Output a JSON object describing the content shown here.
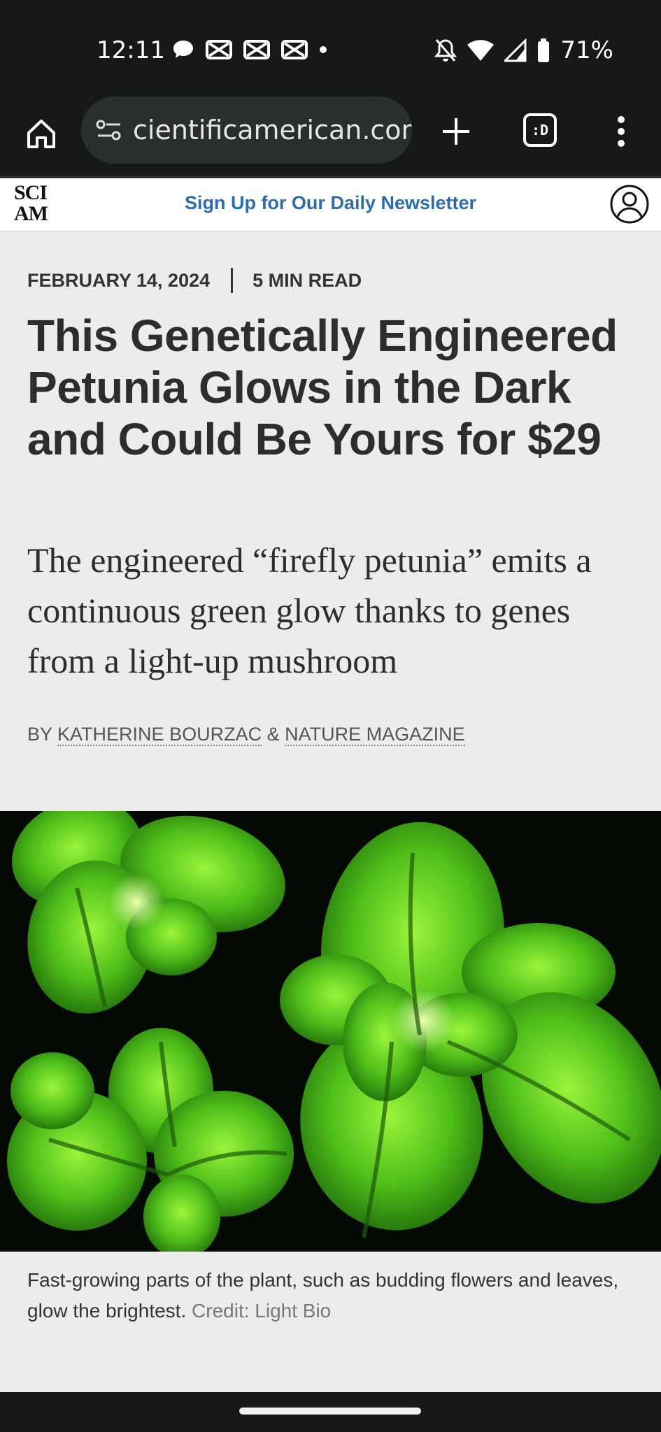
{
  "status_bar": {
    "time": "12:11",
    "battery_percent": "71%",
    "left_icons": [
      "chat-bubble-icon",
      "notification-icon",
      "notification-icon",
      "notification-icon",
      "dot-icon"
    ],
    "right_icons": [
      "bell-off-icon",
      "wifi-icon",
      "cell-signal-icon",
      "battery-icon"
    ]
  },
  "browser": {
    "url": "cientificamerican.com",
    "tabs_label": ":D",
    "icons": [
      "home-icon",
      "tune-icon",
      "plus-icon",
      "tabs-icon",
      "more-vert-icon"
    ]
  },
  "site_header": {
    "logo_line1": "SCI",
    "logo_line2": "AM",
    "newsletter": "Sign Up for Our Daily Newsletter",
    "accent_color": "#2d6ea8"
  },
  "article": {
    "date": "FEBRUARY 14, 2024",
    "read_time": "5 MIN READ",
    "headline": "This Genetically Engineered Petunia Glows in the Dark and Could Be Yours for $29",
    "dek": "The engineered “firefly petunia” emits a continuous green glow thanks to genes from a light-up mushroom",
    "byline_prefix": "BY",
    "author1": "KATHERINE BOURZAC",
    "byline_amp": "&",
    "author2": "NATURE MAGAZINE",
    "caption": "Fast-growing parts of the plant, such as budding flowers and leaves, glow the brightest.",
    "credit": "Credit: Light Bio"
  }
}
